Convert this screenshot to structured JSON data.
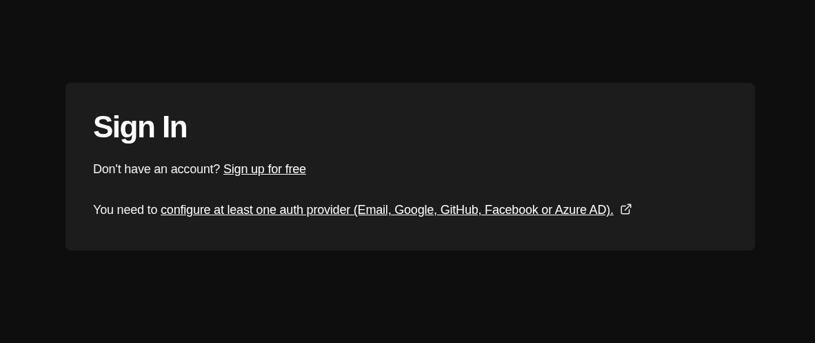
{
  "card": {
    "title": "Sign In",
    "signup_prompt": {
      "text": "Don't have an account?",
      "link": "Sign up for free"
    },
    "provider_notice": {
      "text": "You need to",
      "link": "configure at least one auth provider (Email, Google, GitHub, Facebook or Azure AD).",
      "external": true
    }
  }
}
